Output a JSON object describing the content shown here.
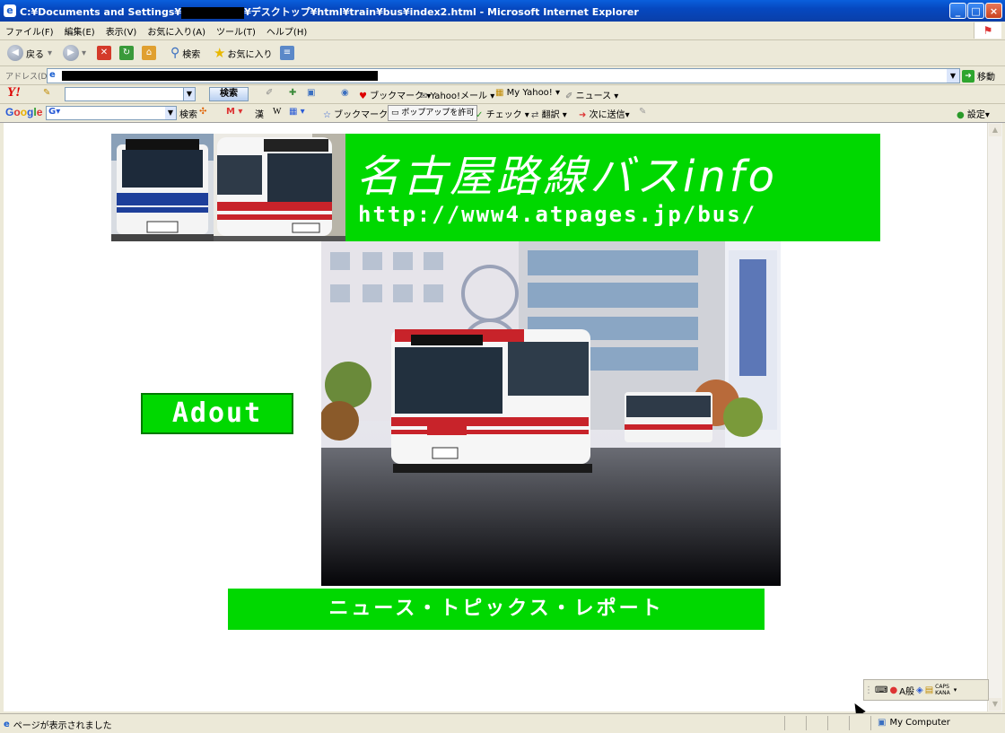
{
  "window": {
    "title_prefix": "C:¥Documents and Settings¥",
    "title_suffix": "¥デスクトップ¥html¥train¥bus¥index2.html - Microsoft Internet Explorer",
    "minimize": "_",
    "maximize": "□",
    "close": "×"
  },
  "menu": [
    "ファイル(F)",
    "編集(E)",
    "表示(V)",
    "お気に入り(A)",
    "ツール(T)",
    "ヘルプ(H)"
  ],
  "toolbar": {
    "back": "戻る",
    "search": "検索",
    "favorites": "お気に入り"
  },
  "address": {
    "label": "アドレス(D)",
    "go": "移動"
  },
  "yahoo_bar": {
    "logo": "Y!",
    "search_button": "検索",
    "bookmarks": "ブックマーク",
    "mail": "Yahoo!メール",
    "my_yahoo": "My Yahoo!",
    "news": "ニュース"
  },
  "google_bar": {
    "logo": "Google",
    "search": "検索",
    "bookmarks": "ブックマーク",
    "popup": "ポップアップを許可",
    "check": "チェック",
    "translate": "翻訳",
    "send": "次に送信",
    "settings": "設定"
  },
  "page": {
    "banner_title": "名古屋路線バスinfo",
    "banner_url": "http://www4.atpages.jp/bus/",
    "about_label": "Adout",
    "news_label": "ニュース・トピックス・レポート"
  },
  "status": {
    "text": "ページが表示されました",
    "zone": "My Computer"
  },
  "ime": {
    "mode": "A般",
    "caps": "CAPS",
    "kana": "KANA"
  },
  "colors": {
    "accent_green": "#00d800",
    "titlebar_blue": "#0a5fdc"
  }
}
